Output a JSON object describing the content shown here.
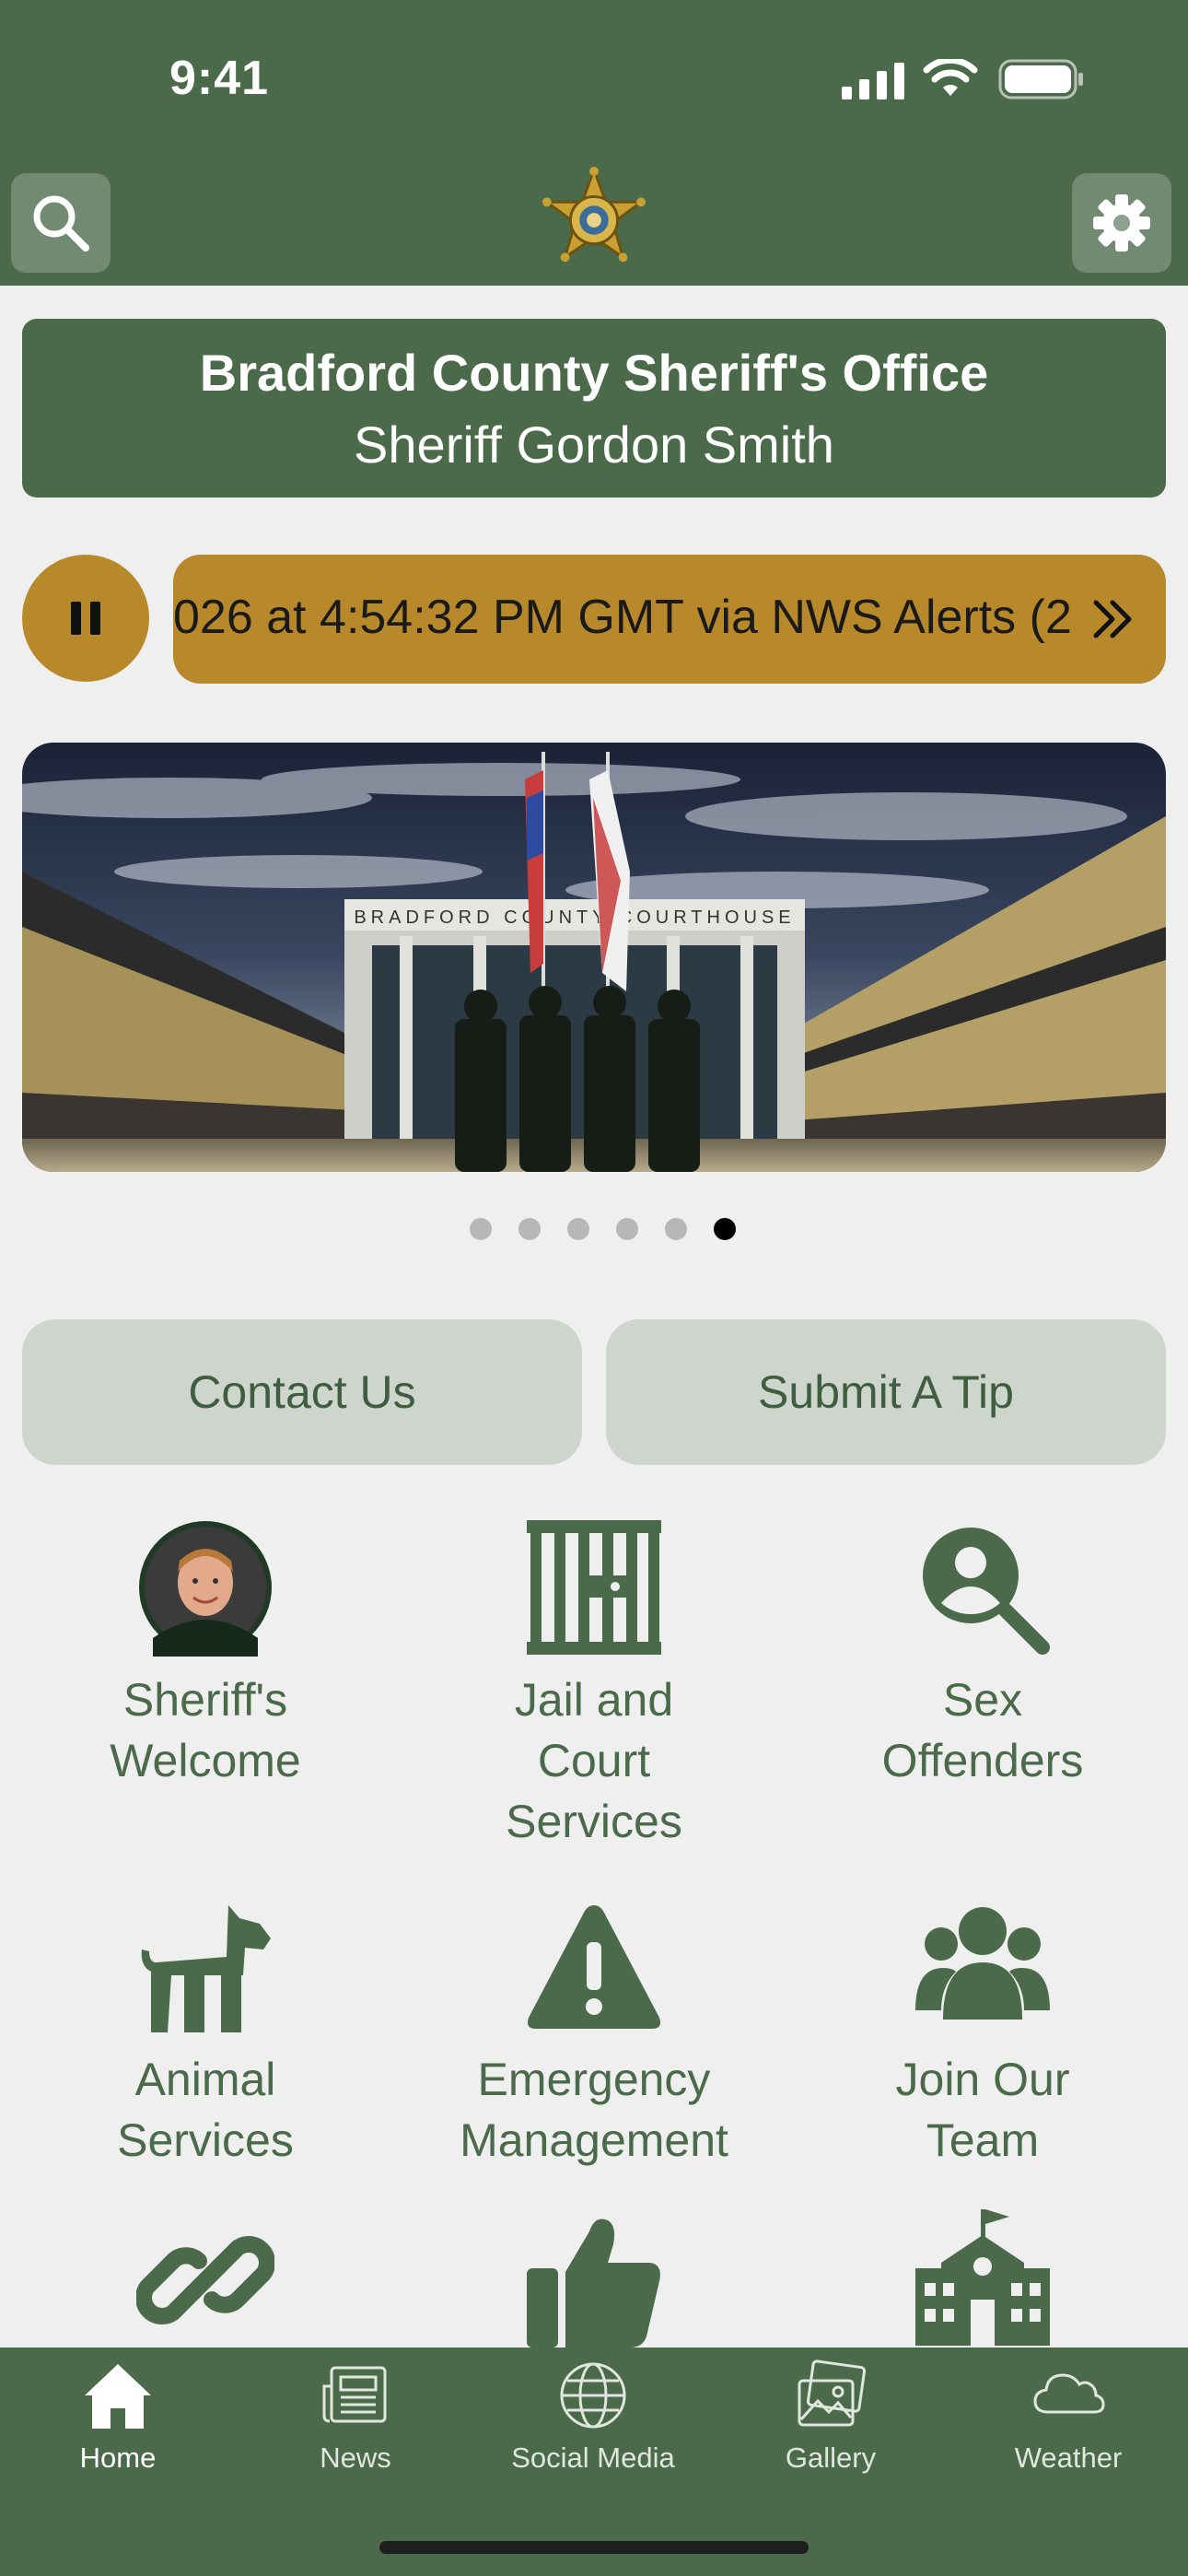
{
  "status_bar": {
    "time": "9:41"
  },
  "header": {
    "search_icon": "search-icon",
    "settings_icon": "gear-icon",
    "logo": "sheriff-star-badge"
  },
  "banner": {
    "title": "Bradford County Sheriff's Office",
    "subtitle": "Sheriff Gordon Smith"
  },
  "alert_ticker": {
    "text": "026 at 4:54:32 PM GMT via NWS Alerts (2",
    "pause_icon": "pause-icon",
    "more_icon": "chevron-double-right-icon"
  },
  "hero": {
    "sign_text": "BRADFORD COUNTY COURTHOUSE",
    "slide_count": 6,
    "active_slide": 6
  },
  "actions": {
    "contact": "Contact Us",
    "tip": "Submit A Tip"
  },
  "grid": [
    {
      "line1": "Sheriff's",
      "line2": "Welcome",
      "line3": "",
      "icon": "sheriff-portrait"
    },
    {
      "line1": "Jail and",
      "line2": "Court",
      "line3": "Services",
      "icon": "jail-icon"
    },
    {
      "line1": "Sex",
      "line2": "Offenders",
      "line3": "",
      "icon": "person-search-icon"
    },
    {
      "line1": "Animal",
      "line2": "Services",
      "line3": "",
      "icon": "dog-icon"
    },
    {
      "line1": "Emergency",
      "line2": "Management",
      "line3": "",
      "icon": "warning-icon"
    },
    {
      "line1": "Join Our",
      "line2": "Team",
      "line3": "",
      "icon": "users-icon"
    },
    {
      "icon": "link-icon"
    },
    {
      "icon": "thumbs-up-icon"
    },
    {
      "icon": "school-icon"
    }
  ],
  "tabs": [
    {
      "label": "Home",
      "icon": "home-icon",
      "active": true
    },
    {
      "label": "News",
      "icon": "newspaper-icon"
    },
    {
      "label": "Social Media",
      "icon": "globe-icon"
    },
    {
      "label": "Gallery",
      "icon": "image-icon"
    },
    {
      "label": "Weather",
      "icon": "cloud-icon"
    }
  ],
  "colors": {
    "brand_green": "#4a6a4a",
    "gold": "#b8892a",
    "light_green": "#cdd5cd",
    "background": "#efefef"
  }
}
